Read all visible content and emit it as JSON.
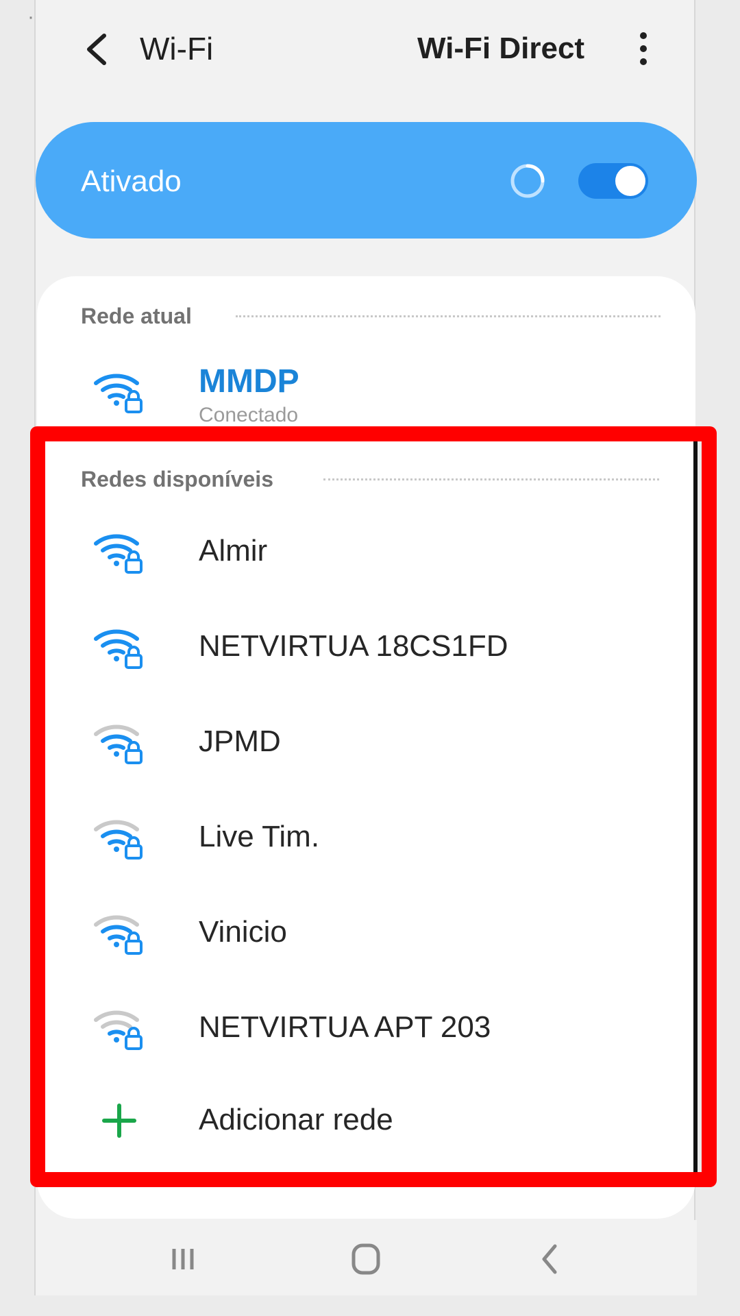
{
  "appbar": {
    "title": "Wi-Fi",
    "wifi_direct": "Wi-Fi Direct"
  },
  "master": {
    "label": "Ativado",
    "enabled": true
  },
  "current": {
    "section": "Rede atual",
    "name": "MMDP",
    "status": "Conectado",
    "signal": "full"
  },
  "available": {
    "section": "Redes disponíveis",
    "networks": [
      {
        "name": "Almir",
        "signal": "full",
        "secured": true
      },
      {
        "name": "NETVIRTUA 18CS1FD",
        "signal": "full",
        "secured": true
      },
      {
        "name": "JPMD",
        "signal": "medium",
        "secured": true
      },
      {
        "name": "Live Tim.",
        "signal": "medium",
        "secured": true
      },
      {
        "name": "Vinicio",
        "signal": "medium",
        "secured": true
      },
      {
        "name": "NETVIRTUA APT 203",
        "signal": "low",
        "secured": true
      }
    ],
    "add_network": "Adicionar rede"
  },
  "colors": {
    "accent": "#4aaaf8",
    "switch": "#1c83e8",
    "signal_active": "#1a8ff0",
    "signal_inactive": "#c9c9c9",
    "highlight": "#ff0000",
    "plus": "#1aa64a"
  }
}
